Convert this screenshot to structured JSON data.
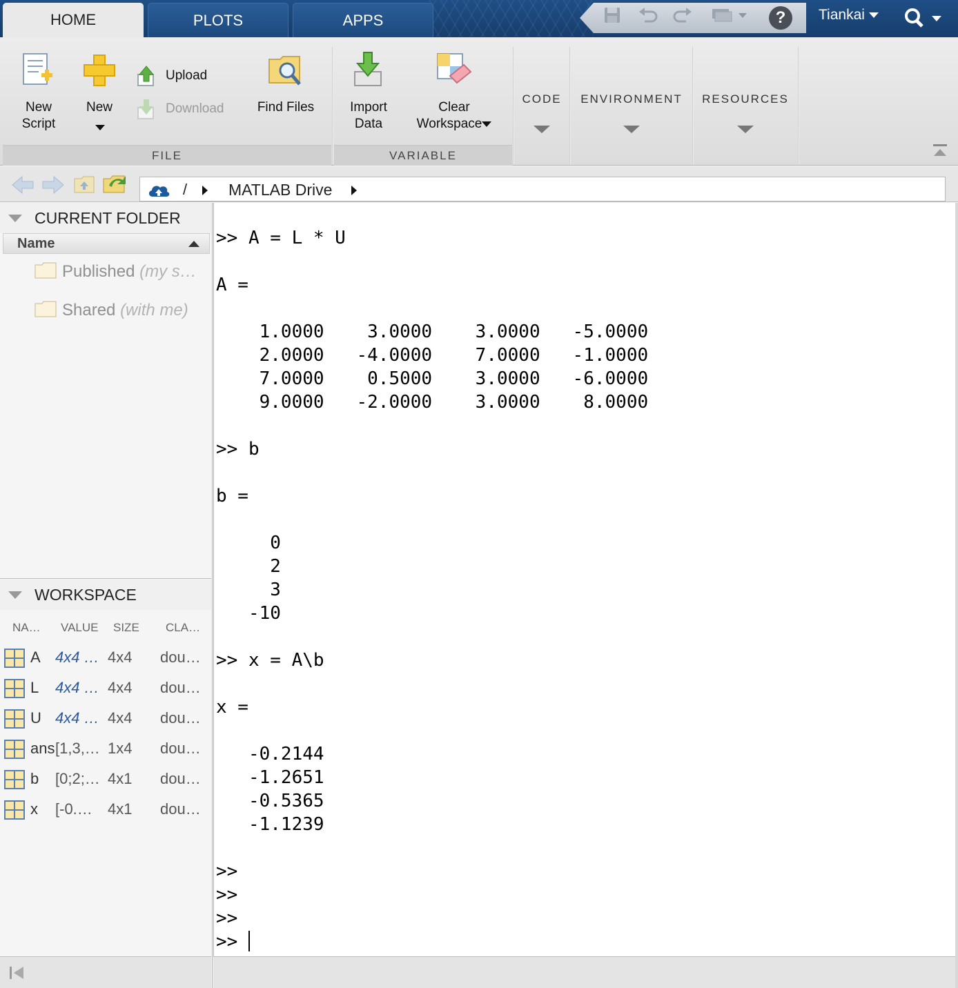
{
  "tabs": [
    {
      "label": "HOME",
      "active": true
    },
    {
      "label": "PLOTS",
      "active": false
    },
    {
      "label": "APPS",
      "active": false
    }
  ],
  "quick_access": {
    "icons": [
      "save-icon",
      "undo-icon",
      "redo-icon",
      "switch-windows-icon",
      "help-icon"
    ],
    "user": "Tiankai",
    "search_icon": "search-icon"
  },
  "ribbon": {
    "file": {
      "title": "FILE",
      "new_script": "New\nScript",
      "new": "New",
      "upload": "Upload",
      "download": "Download",
      "find_files": "Find Files"
    },
    "variable": {
      "title": "VARIABLE",
      "import_data": "Import\nData",
      "clear_workspace_1": "Clear",
      "clear_workspace_2": "Workspace"
    },
    "collapsed": {
      "code": "CODE",
      "environment": "ENVIRONMENT",
      "resources": "RESOURCES"
    }
  },
  "address": {
    "root": "/",
    "folder": "MATLAB Drive"
  },
  "current_folder": {
    "title": "CURRENT FOLDER",
    "column": "Name",
    "items": [
      {
        "name": "Published",
        "suffix": "(my s…"
      },
      {
        "name": "Shared",
        "suffix": "(with me)"
      }
    ]
  },
  "workspace": {
    "title": "WORKSPACE",
    "columns": [
      "NA…",
      "VALUE",
      "SIZE",
      "CLA…"
    ],
    "rows": [
      {
        "name": "A",
        "value": "4x4 …",
        "size": "4x4",
        "class": "dou…",
        "matrix": true
      },
      {
        "name": "L",
        "value": "4x4 …",
        "size": "4x4",
        "class": "dou…",
        "matrix": true
      },
      {
        "name": "U",
        "value": "4x4 …",
        "size": "4x4",
        "class": "dou…",
        "matrix": true
      },
      {
        "name": "ans",
        "value": "[1,3,…",
        "size": "1x4",
        "class": "dou…",
        "matrix": false
      },
      {
        "name": "b",
        "value": "[0;2;…",
        "size": "4x1",
        "class": "dou…",
        "matrix": false
      },
      {
        "name": "x",
        "value": "[-0.…",
        "size": "4x1",
        "class": "dou…",
        "matrix": false
      }
    ]
  },
  "command_window": {
    "lines": [
      ">> A = L * U",
      "",
      "A =",
      "",
      "    1.0000    3.0000    3.0000   -5.0000",
      "    2.0000   -4.0000    7.0000   -1.0000",
      "    7.0000    0.5000    3.0000   -6.0000",
      "    9.0000   -2.0000    3.0000    8.0000",
      "",
      ">> b",
      "",
      "b =",
      "",
      "     0",
      "     2",
      "     3",
      "   -10",
      "",
      ">> x = A\\b",
      "",
      "x =",
      "",
      "   -0.2144",
      "   -1.2651",
      "   -0.5365",
      "   -1.1239",
      "",
      ">>",
      ">>",
      ">>"
    ],
    "prompt": ">> "
  },
  "colors": {
    "title_bar": "#1f4f86",
    "matrix_value": "#2a5aa0"
  }
}
